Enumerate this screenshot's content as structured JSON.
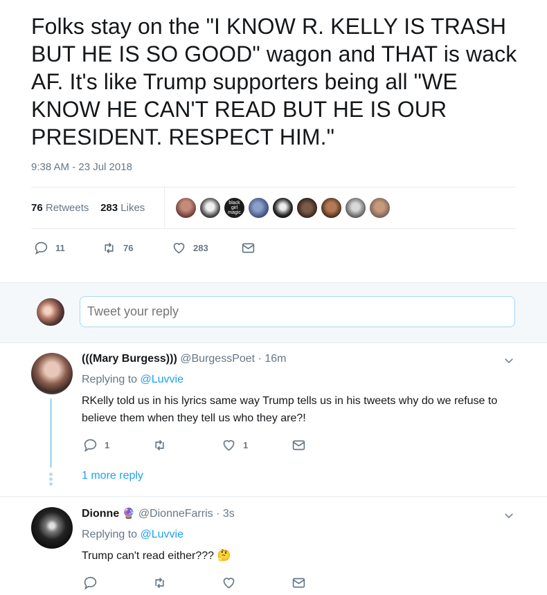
{
  "tweet": {
    "text": "Folks stay on the \"I KNOW R. KELLY IS TRASH BUT HE IS SO GOOD\" wagon and THAT is wack AF. It's like Trump supporters being all \"WE KNOW HE CAN'T READ BUT HE IS OUR PRESIDENT. RESPECT HIM.\"",
    "timestamp": "9:38 AM - 23 Jul 2018",
    "retweets_count": "76",
    "retweets_label": "Retweets",
    "likes_count": "283",
    "likes_label": "Likes",
    "liker_avatars": [
      "liker-avatar-1",
      "liker-avatar-2",
      "liker-avatar-3",
      "liker-avatar-4",
      "liker-avatar-5",
      "liker-avatar-6",
      "liker-avatar-7",
      "liker-avatar-8",
      "liker-avatar-9"
    ],
    "liker_avatar_3_text": "black girl magic",
    "actions": {
      "reply_count": "11",
      "retweet_count": "76",
      "like_count": "283"
    }
  },
  "reply_box": {
    "placeholder": "Tweet your reply"
  },
  "replies": [
    {
      "name": "(((Mary Burgess)))",
      "handle": "@BurgessPoet",
      "time": "· 16m",
      "replying_prefix": "Replying to",
      "replying_to": "@Luvvie",
      "text": "RKelly told us in his lyrics same way Trump tells us in his tweets why do we refuse to believe them when they tell us who they are?!",
      "reply_count": "1",
      "retweet_count": "",
      "like_count": "1",
      "more_replies": "1 more reply"
    },
    {
      "name": "Dionne",
      "badge": "🔮",
      "handle": "@DionneFarris",
      "time": "· 3s",
      "replying_prefix": "Replying to",
      "replying_to": "@Luvvie",
      "text": "Trump can't read either??? 🤔",
      "reply_count": "",
      "retweet_count": "",
      "like_count": ""
    }
  ],
  "icons": {
    "reply": "reply-icon",
    "retweet": "retweet-icon",
    "like": "heart-icon",
    "dm": "envelope-icon",
    "menu": "chevron-down-icon"
  },
  "colors": {
    "link": "#1da1f2",
    "muted": "#657786",
    "thread_line": "#b3dcf2"
  }
}
